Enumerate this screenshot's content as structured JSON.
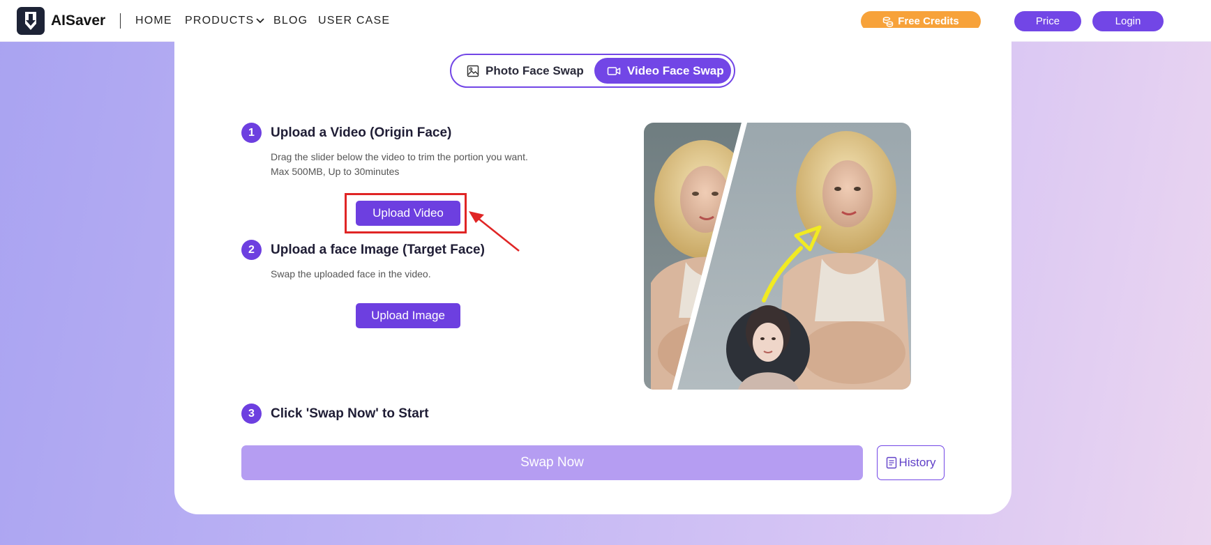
{
  "brand": {
    "name": "AISaver",
    "logo_icon": "download-shield-icon",
    "logo_bg": "#1d2336"
  },
  "nav": {
    "home": "HOME",
    "products": "PRODUCTS",
    "blog": "BLOG",
    "user_case": "USER CASE"
  },
  "header_actions": {
    "free_credits": "Free Credits",
    "price": "Price",
    "login": "Login"
  },
  "tabs": {
    "photo": "Photo Face Swap",
    "video": "Video Face Swap",
    "active": "video"
  },
  "steps": [
    {
      "number": "1",
      "title": "Upload a Video (Origin Face)",
      "desc_line1": "Drag the slider below the video to trim the portion you want.",
      "desc_line2": "Max 500MB, Up to 30minutes",
      "button": "Upload Video"
    },
    {
      "number": "2",
      "title": "Upload a face Image (Target Face)",
      "desc_line1": "Swap the uploaded face in the video.",
      "button": "Upload Image"
    },
    {
      "number": "3",
      "title": "Click 'Swap Now' to Start"
    }
  ],
  "actions": {
    "swap_now": "Swap Now",
    "history": "History"
  },
  "colors": {
    "accent": "#6d3fe0",
    "credits": "#f7a23a",
    "swap_disabled": "#b59df2",
    "highlight": "#e02525"
  }
}
